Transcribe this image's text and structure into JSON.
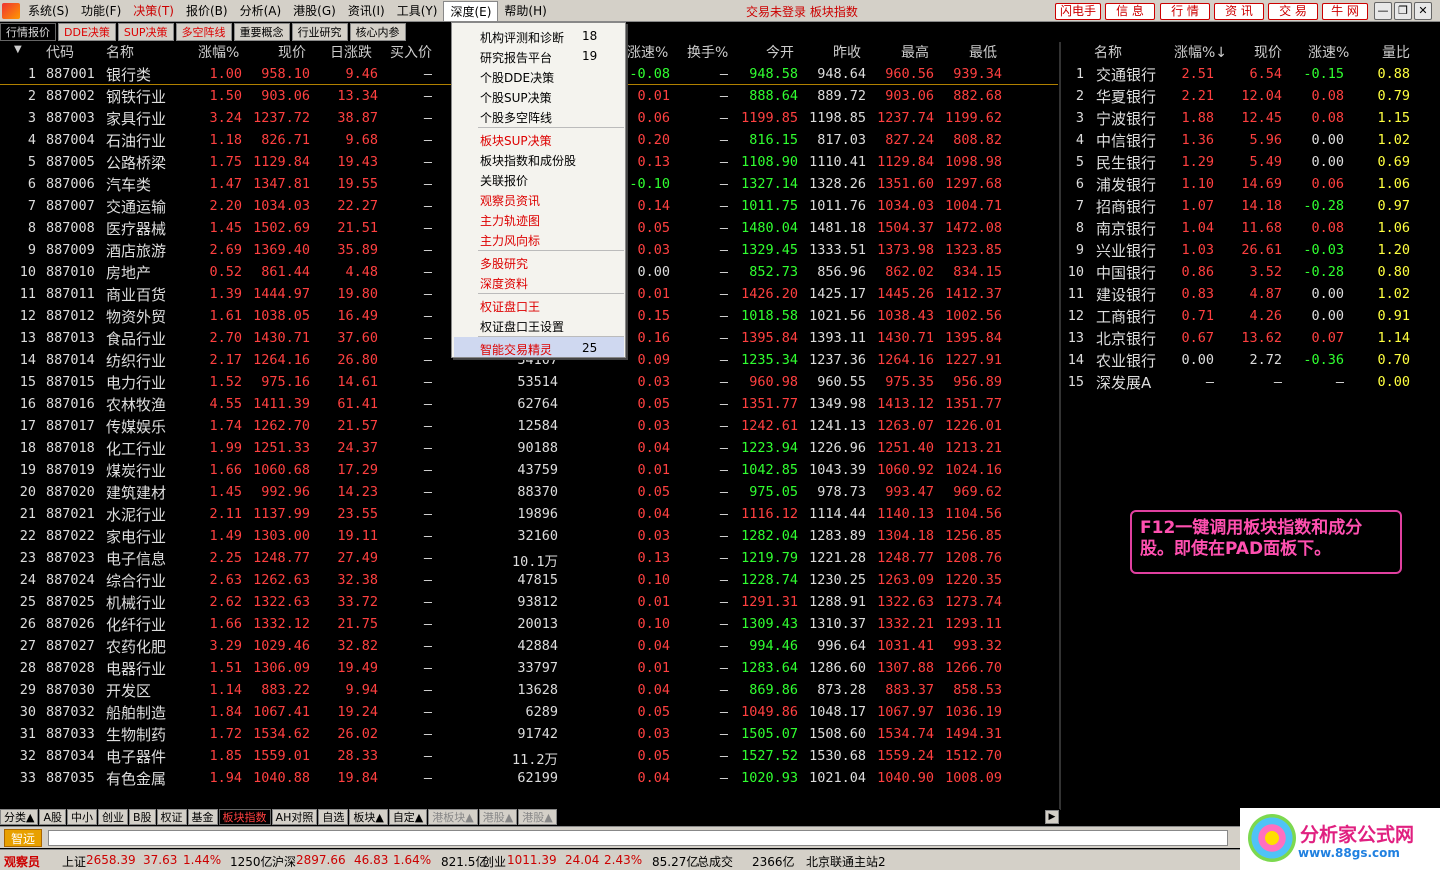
{
  "menubar": {
    "items": [
      "系统(S)",
      "功能(F)",
      "决策(T)",
      "报价(B)",
      "分析(A)",
      "港股(G)",
      "资讯(I)",
      "工具(Y)",
      "深度(E)",
      "帮助(H)"
    ],
    "center_text": "交易未登录 板块指数",
    "right_buttons": [
      "闪电手",
      "信 息",
      "行 情",
      "资 讯",
      "交 易",
      "牛 网"
    ]
  },
  "tabs": [
    "行情报价",
    "DDE决策",
    "SUP决策",
    "多空阵线",
    "重要概念",
    "行业研究",
    "核心内参"
  ],
  "table": {
    "columns": [
      "代码",
      "名称",
      "涨幅%",
      "现价",
      "日涨跌",
      "买入价",
      "涨速%",
      "换手%",
      "今开",
      "昨收",
      "最高",
      "最低"
    ],
    "rows": [
      {
        "n": "1",
        "code": "887001",
        "name": "银行类",
        "pct": "1.00",
        "price": "958.10",
        "chg": "9.46",
        "buy": "—",
        "vol": "",
        "spd": "-0.08",
        "turn": "—",
        "open": "948.58",
        "prev": "948.64",
        "high": "960.56",
        "low": "939.34"
      },
      {
        "n": "2",
        "code": "887002",
        "name": "钢铁行业",
        "pct": "1.50",
        "price": "903.06",
        "chg": "13.34",
        "buy": "—",
        "vol": "",
        "spd": "0.01",
        "turn": "—",
        "open": "888.64",
        "prev": "889.72",
        "high": "903.06",
        "low": "882.68"
      },
      {
        "n": "3",
        "code": "887003",
        "name": "家具行业",
        "pct": "3.24",
        "price": "1237.72",
        "chg": "38.87",
        "buy": "—",
        "vol": "",
        "spd": "0.06",
        "turn": "—",
        "open": "1199.85",
        "prev": "1198.85",
        "high": "1237.74",
        "low": "1199.62"
      },
      {
        "n": "4",
        "code": "887004",
        "name": "石油行业",
        "pct": "1.18",
        "price": "826.71",
        "chg": "9.68",
        "buy": "—",
        "vol": "",
        "spd": "0.20",
        "turn": "—",
        "open": "816.15",
        "prev": "817.03",
        "high": "827.24",
        "low": "808.82"
      },
      {
        "n": "5",
        "code": "887005",
        "name": "公路桥梁",
        "pct": "1.75",
        "price": "1129.84",
        "chg": "19.43",
        "buy": "—",
        "vol": "",
        "spd": "0.13",
        "turn": "—",
        "open": "1108.90",
        "prev": "1110.41",
        "high": "1129.84",
        "low": "1098.98"
      },
      {
        "n": "6",
        "code": "887006",
        "name": "汽车类",
        "pct": "1.47",
        "price": "1347.81",
        "chg": "19.55",
        "buy": "—",
        "vol": "",
        "spd": "-0.10",
        "turn": "—",
        "open": "1327.14",
        "prev": "1328.26",
        "high": "1351.60",
        "low": "1297.68"
      },
      {
        "n": "7",
        "code": "887007",
        "name": "交通运输",
        "pct": "2.20",
        "price": "1034.03",
        "chg": "22.27",
        "buy": "—",
        "vol": "",
        "spd": "0.14",
        "turn": "—",
        "open": "1011.75",
        "prev": "1011.76",
        "high": "1034.03",
        "low": "1004.71"
      },
      {
        "n": "8",
        "code": "887008",
        "name": "医疗器械",
        "pct": "1.45",
        "price": "1502.69",
        "chg": "21.51",
        "buy": "—",
        "vol": "",
        "spd": "0.05",
        "turn": "—",
        "open": "1480.04",
        "prev": "1481.18",
        "high": "1504.37",
        "low": "1472.08"
      },
      {
        "n": "9",
        "code": "887009",
        "name": "酒店旅游",
        "pct": "2.69",
        "price": "1369.40",
        "chg": "35.89",
        "buy": "—",
        "vol": "",
        "spd": "0.03",
        "turn": "—",
        "open": "1329.45",
        "prev": "1333.51",
        "high": "1373.98",
        "low": "1323.85"
      },
      {
        "n": "10",
        "code": "887010",
        "name": "房地产",
        "pct": "0.52",
        "price": "861.44",
        "chg": "4.48",
        "buy": "—",
        "vol": "",
        "spd": "0.00",
        "turn": "—",
        "open": "852.73",
        "prev": "856.96",
        "high": "862.02",
        "low": "834.15"
      },
      {
        "n": "11",
        "code": "887011",
        "name": "商业百货",
        "pct": "1.39",
        "price": "1444.97",
        "chg": "19.80",
        "buy": "—",
        "vol": "",
        "spd": "0.01",
        "turn": "—",
        "open": "1426.20",
        "prev": "1425.17",
        "high": "1445.26",
        "low": "1412.37"
      },
      {
        "n": "12",
        "code": "887012",
        "name": "物资外贸",
        "pct": "1.61",
        "price": "1038.05",
        "chg": "16.49",
        "buy": "—",
        "vol": "",
        "spd": "0.15",
        "turn": "—",
        "open": "1018.58",
        "prev": "1021.56",
        "high": "1038.43",
        "low": "1002.56"
      },
      {
        "n": "13",
        "code": "887013",
        "name": "食品行业",
        "pct": "2.70",
        "price": "1430.71",
        "chg": "37.60",
        "buy": "—",
        "vol": "",
        "spd": "0.16",
        "turn": "—",
        "open": "1395.84",
        "prev": "1393.11",
        "high": "1430.71",
        "low": "1395.84"
      },
      {
        "n": "14",
        "code": "887014",
        "name": "纺织行业",
        "pct": "2.17",
        "price": "1264.16",
        "chg": "26.80",
        "buy": "—",
        "vol": "34107",
        "spd": "0.09",
        "turn": "—",
        "open": "1235.34",
        "prev": "1237.36",
        "high": "1264.16",
        "low": "1227.91"
      },
      {
        "n": "15",
        "code": "887015",
        "name": "电力行业",
        "pct": "1.52",
        "price": "975.16",
        "chg": "14.61",
        "buy": "—",
        "vol": "53514",
        "spd": "0.03",
        "turn": "—",
        "open": "960.98",
        "prev": "960.55",
        "high": "975.35",
        "low": "956.89"
      },
      {
        "n": "16",
        "code": "887016",
        "name": "农林牧渔",
        "pct": "4.55",
        "price": "1411.39",
        "chg": "61.41",
        "buy": "—",
        "vol": "62764",
        "spd": "0.05",
        "turn": "—",
        "open": "1351.77",
        "prev": "1349.98",
        "high": "1413.12",
        "low": "1351.77"
      },
      {
        "n": "17",
        "code": "887017",
        "name": "传媒娱乐",
        "pct": "1.74",
        "price": "1262.70",
        "chg": "21.57",
        "buy": "—",
        "vol": "12584",
        "spd": "0.03",
        "turn": "—",
        "open": "1242.61",
        "prev": "1241.13",
        "high": "1263.07",
        "low": "1226.01"
      },
      {
        "n": "18",
        "code": "887018",
        "name": "化工行业",
        "pct": "1.99",
        "price": "1251.33",
        "chg": "24.37",
        "buy": "—",
        "vol": "90188",
        "spd": "0.04",
        "turn": "—",
        "open": "1223.94",
        "prev": "1226.96",
        "high": "1251.40",
        "low": "1213.21"
      },
      {
        "n": "19",
        "code": "887019",
        "name": "煤炭行业",
        "pct": "1.66",
        "price": "1060.68",
        "chg": "17.29",
        "buy": "—",
        "vol": "43759",
        "spd": "0.01",
        "turn": "—",
        "open": "1042.85",
        "prev": "1043.39",
        "high": "1060.92",
        "low": "1024.16"
      },
      {
        "n": "20",
        "code": "887020",
        "name": "建筑建材",
        "pct": "1.45",
        "price": "992.96",
        "chg": "14.23",
        "buy": "—",
        "vol": "88370",
        "spd": "0.05",
        "turn": "—",
        "open": "975.05",
        "prev": "978.73",
        "high": "993.47",
        "low": "969.62"
      },
      {
        "n": "21",
        "code": "887021",
        "name": "水泥行业",
        "pct": "2.11",
        "price": "1137.99",
        "chg": "23.55",
        "buy": "—",
        "vol": "19896",
        "spd": "0.04",
        "turn": "—",
        "open": "1116.12",
        "prev": "1114.44",
        "high": "1140.13",
        "low": "1104.56"
      },
      {
        "n": "22",
        "code": "887022",
        "name": "家电行业",
        "pct": "1.49",
        "price": "1303.00",
        "chg": "19.11",
        "buy": "—",
        "vol": "32160",
        "spd": "0.03",
        "turn": "—",
        "open": "1282.04",
        "prev": "1283.89",
        "high": "1304.18",
        "low": "1256.85"
      },
      {
        "n": "23",
        "code": "887023",
        "name": "电子信息",
        "pct": "2.25",
        "price": "1248.77",
        "chg": "27.49",
        "buy": "—",
        "vol": "10.1万",
        "spd": "0.13",
        "turn": "—",
        "open": "1219.79",
        "prev": "1221.28",
        "high": "1248.77",
        "low": "1208.76"
      },
      {
        "n": "24",
        "code": "887024",
        "name": "综合行业",
        "pct": "2.63",
        "price": "1262.63",
        "chg": "32.38",
        "buy": "—",
        "vol": "47815",
        "spd": "0.10",
        "turn": "—",
        "open": "1228.74",
        "prev": "1230.25",
        "high": "1263.09",
        "low": "1220.35"
      },
      {
        "n": "25",
        "code": "887025",
        "name": "机械行业",
        "pct": "2.62",
        "price": "1322.63",
        "chg": "33.72",
        "buy": "—",
        "vol": "93812",
        "spd": "0.01",
        "turn": "—",
        "open": "1291.31",
        "prev": "1288.91",
        "high": "1322.63",
        "low": "1273.74"
      },
      {
        "n": "26",
        "code": "887026",
        "name": "化纤行业",
        "pct": "1.66",
        "price": "1332.12",
        "chg": "21.75",
        "buy": "—",
        "vol": "20013",
        "spd": "0.10",
        "turn": "—",
        "open": "1309.43",
        "prev": "1310.37",
        "high": "1332.21",
        "low": "1293.11"
      },
      {
        "n": "27",
        "code": "887027",
        "name": "农药化肥",
        "pct": "3.29",
        "price": "1029.46",
        "chg": "32.82",
        "buy": "—",
        "vol": "42884",
        "spd": "0.04",
        "turn": "—",
        "open": "994.46",
        "prev": "996.64",
        "high": "1031.41",
        "low": "993.32"
      },
      {
        "n": "28",
        "code": "887028",
        "name": "电器行业",
        "pct": "1.51",
        "price": "1306.09",
        "chg": "19.49",
        "buy": "—",
        "vol": "33797",
        "spd": "0.01",
        "turn": "—",
        "open": "1283.64",
        "prev": "1286.60",
        "high": "1307.88",
        "low": "1266.70"
      },
      {
        "n": "29",
        "code": "887030",
        "name": "开发区",
        "pct": "1.14",
        "price": "883.22",
        "chg": "9.94",
        "buy": "—",
        "vol": "13628",
        "spd": "0.04",
        "turn": "—",
        "open": "869.86",
        "prev": "873.28",
        "high": "883.37",
        "low": "858.53"
      },
      {
        "n": "30",
        "code": "887032",
        "name": "船舶制造",
        "pct": "1.84",
        "price": "1067.41",
        "chg": "19.24",
        "buy": "—",
        "vol": "6289",
        "spd": "0.05",
        "turn": "—",
        "open": "1049.86",
        "prev": "1048.17",
        "high": "1067.97",
        "low": "1036.19"
      },
      {
        "n": "31",
        "code": "887033",
        "name": "生物制药",
        "pct": "1.72",
        "price": "1534.62",
        "chg": "26.02",
        "buy": "—",
        "vol": "91742",
        "spd": "0.03",
        "turn": "—",
        "open": "1505.07",
        "prev": "1508.60",
        "high": "1534.74",
        "low": "1494.31"
      },
      {
        "n": "32",
        "code": "887034",
        "name": "电子器件",
        "pct": "1.85",
        "price": "1559.01",
        "chg": "28.33",
        "buy": "—",
        "vol": "11.2万",
        "spd": "0.05",
        "turn": "—",
        "open": "1527.52",
        "prev": "1530.68",
        "high": "1559.24",
        "low": "1512.70"
      },
      {
        "n": "33",
        "code": "887035",
        "name": "有色金属",
        "pct": "1.94",
        "price": "1040.88",
        "chg": "19.84",
        "buy": "—",
        "vol": "62199",
        "spd": "0.04",
        "turn": "—",
        "open": "1020.93",
        "prev": "1021.04",
        "high": "1040.90",
        "low": "1008.09"
      }
    ]
  },
  "right_panel": {
    "columns": [
      "名称",
      "涨幅%↓",
      "现价",
      "涨速%",
      "量比"
    ],
    "rows": [
      {
        "n": "1",
        "name": "交通银行",
        "pct": "2.51",
        "price": "6.54",
        "spd": "-0.15",
        "ratio": "0.88"
      },
      {
        "n": "2",
        "name": "华夏银行",
        "pct": "2.21",
        "price": "12.04",
        "spd": "0.08",
        "ratio": "0.79"
      },
      {
        "n": "3",
        "name": "宁波银行",
        "pct": "1.88",
        "price": "12.45",
        "spd": "0.08",
        "ratio": "1.15"
      },
      {
        "n": "4",
        "name": "中信银行",
        "pct": "1.36",
        "price": "5.96",
        "spd": "0.00",
        "ratio": "1.02"
      },
      {
        "n": "5",
        "name": "民生银行",
        "pct": "1.29",
        "price": "5.49",
        "spd": "0.00",
        "ratio": "0.69"
      },
      {
        "n": "6",
        "name": "浦发银行",
        "pct": "1.10",
        "price": "14.69",
        "spd": "0.06",
        "ratio": "1.06"
      },
      {
        "n": "7",
        "name": "招商银行",
        "pct": "1.07",
        "price": "14.18",
        "spd": "-0.28",
        "ratio": "0.97"
      },
      {
        "n": "8",
        "name": "南京银行",
        "pct": "1.04",
        "price": "11.68",
        "spd": "0.08",
        "ratio": "1.06"
      },
      {
        "n": "9",
        "name": "兴业银行",
        "pct": "1.03",
        "price": "26.61",
        "spd": "-0.03",
        "ratio": "1.20"
      },
      {
        "n": "10",
        "name": "中国银行",
        "pct": "0.86",
        "price": "3.52",
        "spd": "-0.28",
        "ratio": "0.80"
      },
      {
        "n": "11",
        "name": "建设银行",
        "pct": "0.83",
        "price": "4.87",
        "spd": "0.00",
        "ratio": "1.02"
      },
      {
        "n": "12",
        "name": "工商银行",
        "pct": "0.71",
        "price": "4.26",
        "spd": "0.00",
        "ratio": "0.91"
      },
      {
        "n": "13",
        "name": "北京银行",
        "pct": "0.67",
        "price": "13.62",
        "spd": "0.07",
        "ratio": "1.14"
      },
      {
        "n": "14",
        "name": "农业银行",
        "pct": "0.00",
        "price": "2.72",
        "spd": "-0.36",
        "ratio": "0.70"
      },
      {
        "n": "15",
        "name": "深发展A",
        "pct": "—",
        "price": "—",
        "spd": "—",
        "ratio": "0.00"
      }
    ]
  },
  "dropdown": {
    "items": [
      {
        "label": "机构评测和诊断",
        "shortcut": "18",
        "red": false
      },
      {
        "label": "研究报告平台",
        "shortcut": "19",
        "red": false
      },
      {
        "label": "个股DDE决策",
        "shortcut": "",
        "red": false
      },
      {
        "label": "个股SUP决策",
        "shortcut": "",
        "red": false
      },
      {
        "label": "个股多空阵线",
        "shortcut": "",
        "red": false
      },
      {
        "label": "板块SUP决策",
        "shortcut": "",
        "red": true
      },
      {
        "label": "板块指数和成份股",
        "shortcut": "",
        "red": false
      },
      {
        "label": "关联报价",
        "shortcut": "",
        "red": false
      },
      {
        "label": "观察员资讯",
        "shortcut": "",
        "red": true
      },
      {
        "label": "主力轨迹图",
        "shortcut": "",
        "red": true
      },
      {
        "label": "主力风向标",
        "shortcut": "",
        "red": true
      },
      {
        "label": "多股研究",
        "shortcut": "",
        "red": true
      },
      {
        "label": "深度资料",
        "shortcut": "",
        "red": true
      },
      {
        "label": "权证盘口王",
        "shortcut": "",
        "red": true
      },
      {
        "label": "权证盘口王设置",
        "shortcut": "",
        "red": false
      },
      {
        "label": "智能交易精灵",
        "shortcut": "25",
        "red": true
      }
    ]
  },
  "bottom_tabs": [
    "分类▲",
    "A股",
    "中小",
    "创业",
    "B股",
    "权证",
    "基金",
    "板块指数",
    "AH对照",
    "自选",
    "板块▲",
    "自定▲",
    "港板块▲",
    "港股▲",
    "港股▲"
  ],
  "cmdbar": {
    "logo": "智远"
  },
  "status": {
    "label": "观察员",
    "sh_name": "上证",
    "sh_val": "2658.39",
    "sh_chg": "37.63",
    "sh_pct": "1.44%",
    "sh_amt": "1250亿",
    "sz_name": "沪深",
    "sz_val": "2897.66",
    "sz_chg": "46.83",
    "sz_pct": "1.64%",
    "sz_amt": "821.5亿",
    "cy_name": "创业",
    "cy_val": "1011.39",
    "cy_chg": "24.04",
    "cy_pct": "2.43%",
    "cy_amt": "85.27亿",
    "total_label": "总成交",
    "total_amt": "2366亿",
    "server": "北京联通主站2"
  },
  "annotation": "F12一键调用板块指数和成分股。即使在PAD面板下。",
  "brand": {
    "name": "分析家公式网",
    "url": "www.88gs.com"
  },
  "colors": {
    "up": "#ff4040",
    "down": "#30ff30",
    "accent": "#e040a0"
  }
}
